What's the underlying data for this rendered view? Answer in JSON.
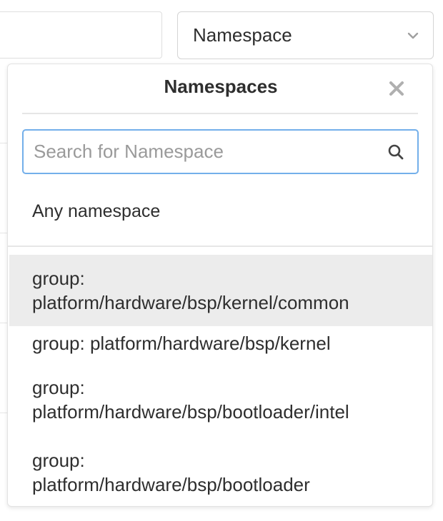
{
  "namespace_toggle": {
    "label": "Namespace",
    "chevron_icon": "chevron-down-icon"
  },
  "dropdown": {
    "title": "Namespaces",
    "close_icon": "close-icon",
    "search": {
      "placeholder": "Search for Namespace",
      "value": "",
      "icon": "search-icon"
    },
    "any_option": "Any namespace",
    "items": [
      {
        "line1": "group:",
        "line2": "platform/hardware/bsp/kernel/common",
        "highlighted": true
      },
      {
        "line1": "group: platform/hardware/bsp/kernel",
        "line2": "",
        "highlighted": false
      },
      {
        "line1": "group:",
        "line2": "platform/hardware/bsp/bootloader/intel",
        "highlighted": false
      },
      {
        "line1": "group:",
        "line2": "platform/hardware/bsp/bootloader",
        "highlighted": false
      }
    ]
  },
  "colors": {
    "focus_border": "#73afea",
    "highlight_bg": "#ececec",
    "text": "#2e2e2e",
    "placeholder": "#9a9a9a"
  }
}
